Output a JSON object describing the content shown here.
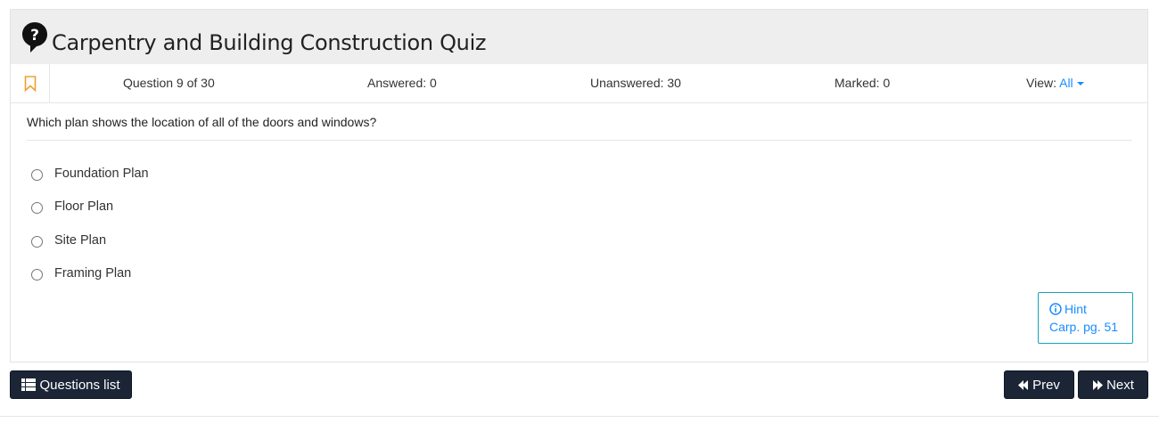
{
  "header": {
    "title": "Carpentry and Building Construction Quiz",
    "logo_icon": "question-bubble-icon"
  },
  "status": {
    "question_progress": "Question 9 of 30",
    "answered": "Answered: 0",
    "unanswered": "Unanswered: 30",
    "marked": "Marked: 0",
    "view_label": "View:",
    "view_value": "All",
    "bookmark_icon": "bookmark-icon"
  },
  "question": {
    "text": "Which plan shows the location of all of the doors and windows?",
    "options": [
      {
        "label": "Foundation Plan",
        "selected": false
      },
      {
        "label": "Floor Plan",
        "selected": false
      },
      {
        "label": "Site Plan",
        "selected": false
      },
      {
        "label": "Framing Plan",
        "selected": false
      }
    ]
  },
  "hint": {
    "label": "Hint",
    "reference": "Carp. pg. 51",
    "icon": "info-icon"
  },
  "nav": {
    "questions_list": "Questions list",
    "prev": "Prev",
    "next": "Next"
  },
  "colors": {
    "accent": "#1a8cff",
    "bookmark": "#f0a030",
    "button_bg": "#1b2536",
    "header_bg": "#eeeeee",
    "hint_border": "#17a2b8"
  }
}
